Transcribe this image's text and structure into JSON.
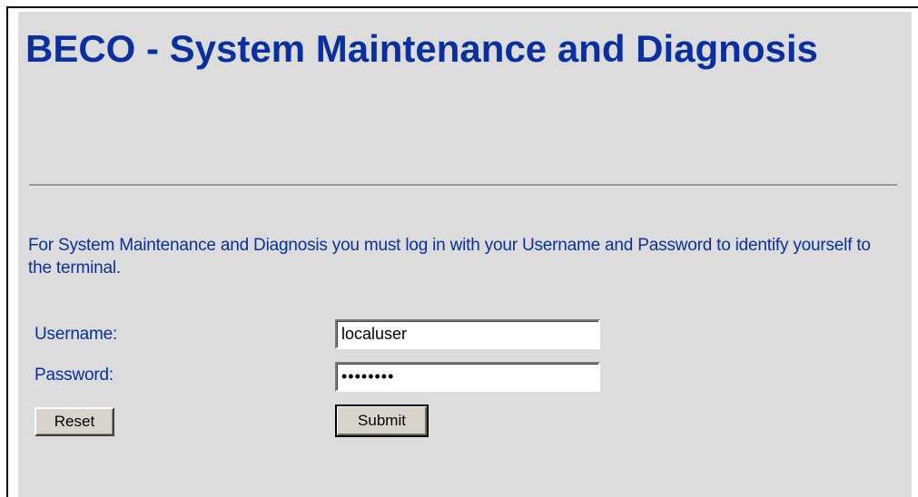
{
  "page": {
    "title": "BECO - System Maintenance and Diagnosis",
    "intro": "For System Maintenance and Diagnosis you must log in with your Username and Password to identify yourself to the terminal."
  },
  "form": {
    "username_label": "Username:",
    "username_value": "localuser",
    "password_label": "Password:",
    "password_value": "••••••••",
    "reset_label": "Reset",
    "submit_label": "Submit"
  },
  "colors": {
    "heading_text": "#0a2f9e",
    "panel_background": "#dcdcdc",
    "divider": "#9a958c"
  }
}
